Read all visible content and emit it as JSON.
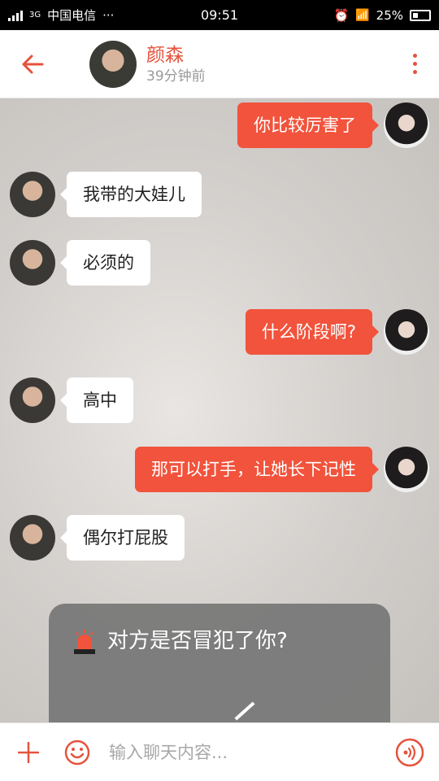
{
  "status_bar": {
    "network": "3G",
    "carrier": "中国电信",
    "more": "···",
    "time": "09:51",
    "battery": "25%"
  },
  "header": {
    "contact_name": "颜森",
    "last_seen": "39分钟前"
  },
  "messages": [
    {
      "direction": "out",
      "text": "你比较厉害了"
    },
    {
      "direction": "in",
      "text": "我带的大娃儿"
    },
    {
      "direction": "in",
      "text": "必须的"
    },
    {
      "direction": "out",
      "text": "什么阶段啊?"
    },
    {
      "direction": "in",
      "text": "高中"
    },
    {
      "direction": "out",
      "text": "那可以打手，让她长下记性"
    },
    {
      "direction": "in",
      "text": "偶尔打屁股"
    }
  ],
  "report_panel": {
    "prompt": "对方是否冒犯了你?"
  },
  "input_bar": {
    "placeholder": "输入聊天内容..."
  },
  "colors": {
    "accent": "#f1533c",
    "header_text": "#e5533d",
    "incoming_bubble": "#ffffff",
    "panel": "#767676"
  }
}
